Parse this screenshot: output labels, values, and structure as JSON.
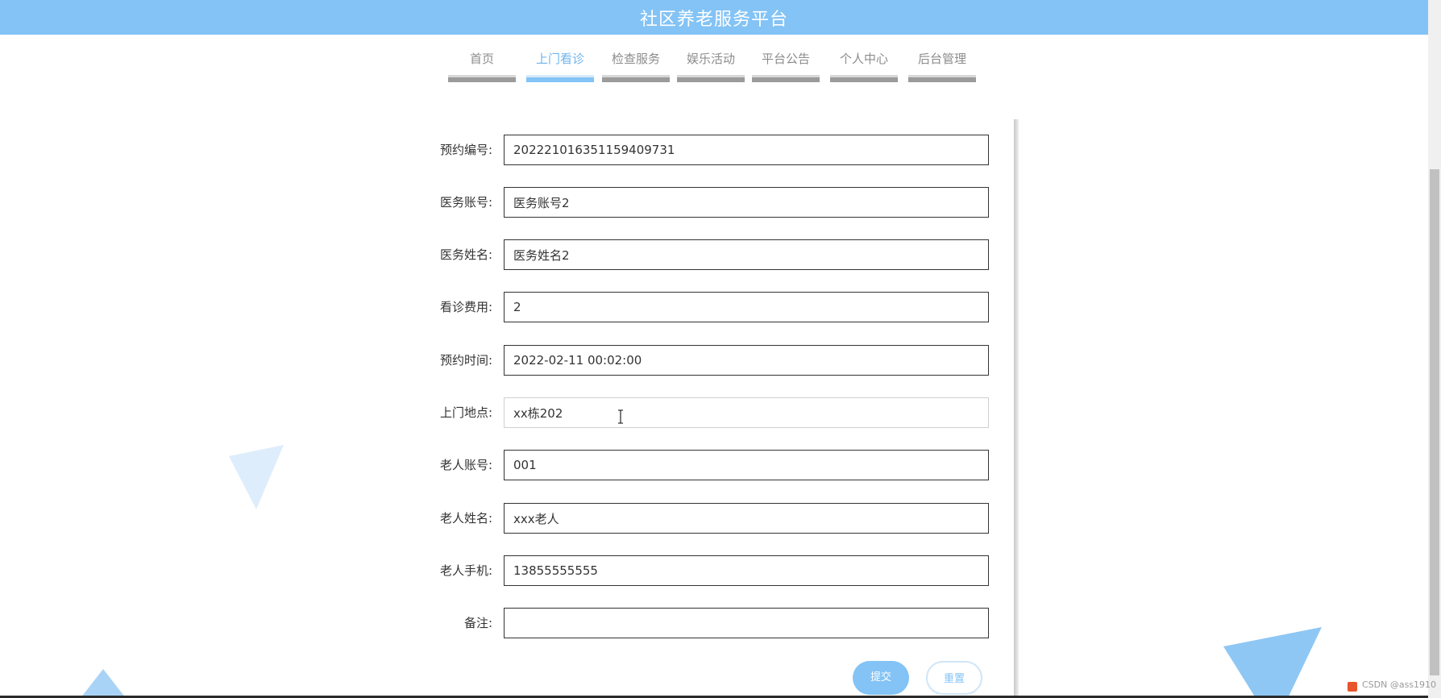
{
  "header": {
    "title": "社区养老服务平台"
  },
  "nav": {
    "items": [
      {
        "label": "首页"
      },
      {
        "label": "上门看诊"
      },
      {
        "label": "检查服务"
      },
      {
        "label": "娱乐活动"
      },
      {
        "label": "平台公告"
      },
      {
        "label": "个人中心"
      },
      {
        "label": "后台管理"
      }
    ],
    "active_index": 1
  },
  "form": {
    "fields": [
      {
        "label": "预约编号:",
        "value": "202221016351159409731"
      },
      {
        "label": "医务账号:",
        "value": "医务账号2"
      },
      {
        "label": "医务姓名:",
        "value": "医务姓名2"
      },
      {
        "label": "看诊费用:",
        "value": "2"
      },
      {
        "label": "预约时间:",
        "value": "2022-02-11 00:02:00"
      },
      {
        "label": "上门地点:",
        "value": "xx栋202"
      },
      {
        "label": "老人账号:",
        "value": "001"
      },
      {
        "label": "老人姓名:",
        "value": "xxx老人"
      },
      {
        "label": "老人手机:",
        "value": "13855555555"
      },
      {
        "label": "备注:",
        "value": ""
      }
    ],
    "submit_label": "提交",
    "reset_label": "重置"
  },
  "watermark": {
    "text": "CSDN @ass1910"
  },
  "colors": {
    "accent": "#83c3f5",
    "nav_inactive": "#8c8c8c",
    "text": "#333333"
  },
  "icons": {
    "text_cursor": "text-cursor-icon"
  }
}
